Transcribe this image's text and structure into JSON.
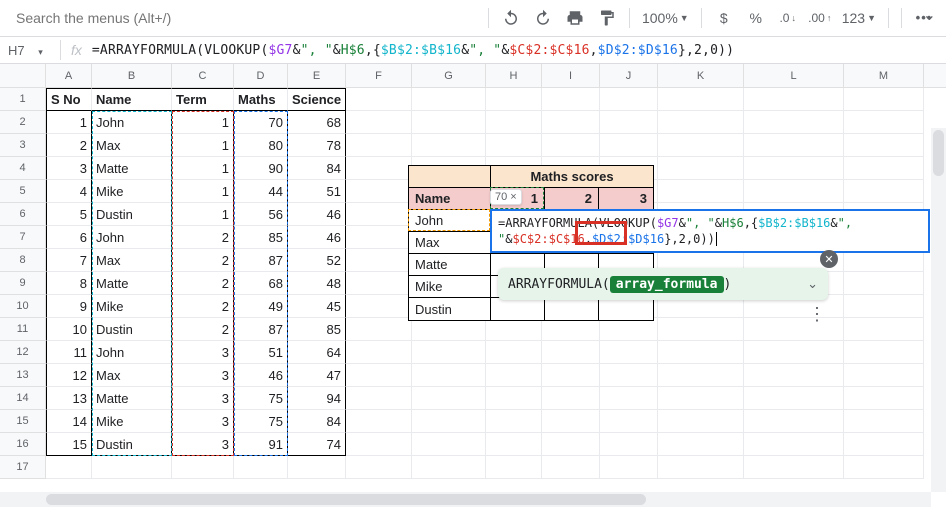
{
  "toolbar": {
    "search_placeholder": "Search the menus (Alt+/)",
    "zoom": "100%",
    "format_more": "123"
  },
  "name_box": "H7",
  "fx": "fx",
  "formula": {
    "p1": "=ARRAYFORMULA(",
    "p2": "VLOOKUP(",
    "p3": "$G7",
    "p4": "&",
    "p5": "\", \"",
    "p6": "&",
    "p7": "H$6",
    "p8": ",{",
    "p9": "$B$2:$B$16",
    "p10": "&",
    "p11": "\", \"",
    "p12": "&",
    "p13": "$C$2:$C$16",
    "p14": ",",
    "p15": "$D$2:$D$16",
    "p16": "},",
    "p17": "2",
    "p18": ",",
    "p19": "0",
    "p20": "))"
  },
  "columns": [
    "A",
    "B",
    "C",
    "D",
    "E",
    "F",
    "G",
    "H",
    "I",
    "J",
    "K",
    "L",
    "M"
  ],
  "headers": {
    "a": "S No",
    "b": "Name",
    "c": "Term",
    "d": "Maths",
    "e": "Science"
  },
  "rows": [
    {
      "n": "1",
      "a": "1",
      "b": "John",
      "c": "1",
      "d": "70",
      "e": "68"
    },
    {
      "n": "2",
      "a": "2",
      "b": "Max",
      "c": "1",
      "d": "80",
      "e": "78"
    },
    {
      "n": "3",
      "a": "3",
      "b": "Matte",
      "c": "1",
      "d": "90",
      "e": "84"
    },
    {
      "n": "4",
      "a": "4",
      "b": "Mike",
      "c": "1",
      "d": "44",
      "e": "51"
    },
    {
      "n": "5",
      "a": "5",
      "b": "Dustin",
      "c": "1",
      "d": "56",
      "e": "46"
    },
    {
      "n": "6",
      "a": "6",
      "b": "John",
      "c": "2",
      "d": "85",
      "e": "46"
    },
    {
      "n": "7",
      "a": "7",
      "b": "Max",
      "c": "2",
      "d": "87",
      "e": "52"
    },
    {
      "n": "8",
      "a": "8",
      "b": "Matte",
      "c": "2",
      "d": "68",
      "e": "48"
    },
    {
      "n": "9",
      "a": "9",
      "b": "Mike",
      "c": "2",
      "d": "49",
      "e": "45"
    },
    {
      "n": "10",
      "a": "10",
      "b": "Dustin",
      "c": "2",
      "d": "87",
      "e": "85"
    },
    {
      "n": "11",
      "a": "11",
      "b": "John",
      "c": "3",
      "d": "51",
      "e": "64"
    },
    {
      "n": "12",
      "a": "12",
      "b": "Max",
      "c": "3",
      "d": "46",
      "e": "47"
    },
    {
      "n": "13",
      "a": "13",
      "b": "Matte",
      "c": "3",
      "d": "75",
      "e": "94"
    },
    {
      "n": "14",
      "a": "14",
      "b": "Mike",
      "c": "3",
      "d": "75",
      "e": "84"
    },
    {
      "n": "15",
      "a": "15",
      "b": "Dustin",
      "c": "3",
      "d": "91",
      "e": "74"
    }
  ],
  "mini": {
    "title": "Maths scores",
    "name_hdr": "Name",
    "cols": [
      "1",
      "2",
      "3"
    ],
    "names": [
      "John",
      "Max",
      "Matte",
      "Mike",
      "Dustin"
    ]
  },
  "overlay_formula": {
    "l1a": "=ARRAYFORMULA(VLOOKUP(",
    "l1b": "$G7",
    "l1c": "&",
    "l1d": "\", \"",
    "l1e": "&",
    "l1f": "H$6",
    "l1g": ",{",
    "l1h": "$B$2:$B$16",
    "l1i": "&",
    "l1j": "\", \"",
    "l1k": "&",
    "l1l": "$C$2:$C$16",
    "l1m": ",",
    "l2a": "$D$2:$D$16",
    "l2b": "},",
    "l2c": "2",
    "l2d": ",",
    "l2e": "0",
    "l2f": "))"
  },
  "hint": {
    "fn": "ARRAYFORMULA(",
    "arg": "array_formula",
    "close": ")"
  },
  "tip": "70",
  "tip_x": "×"
}
